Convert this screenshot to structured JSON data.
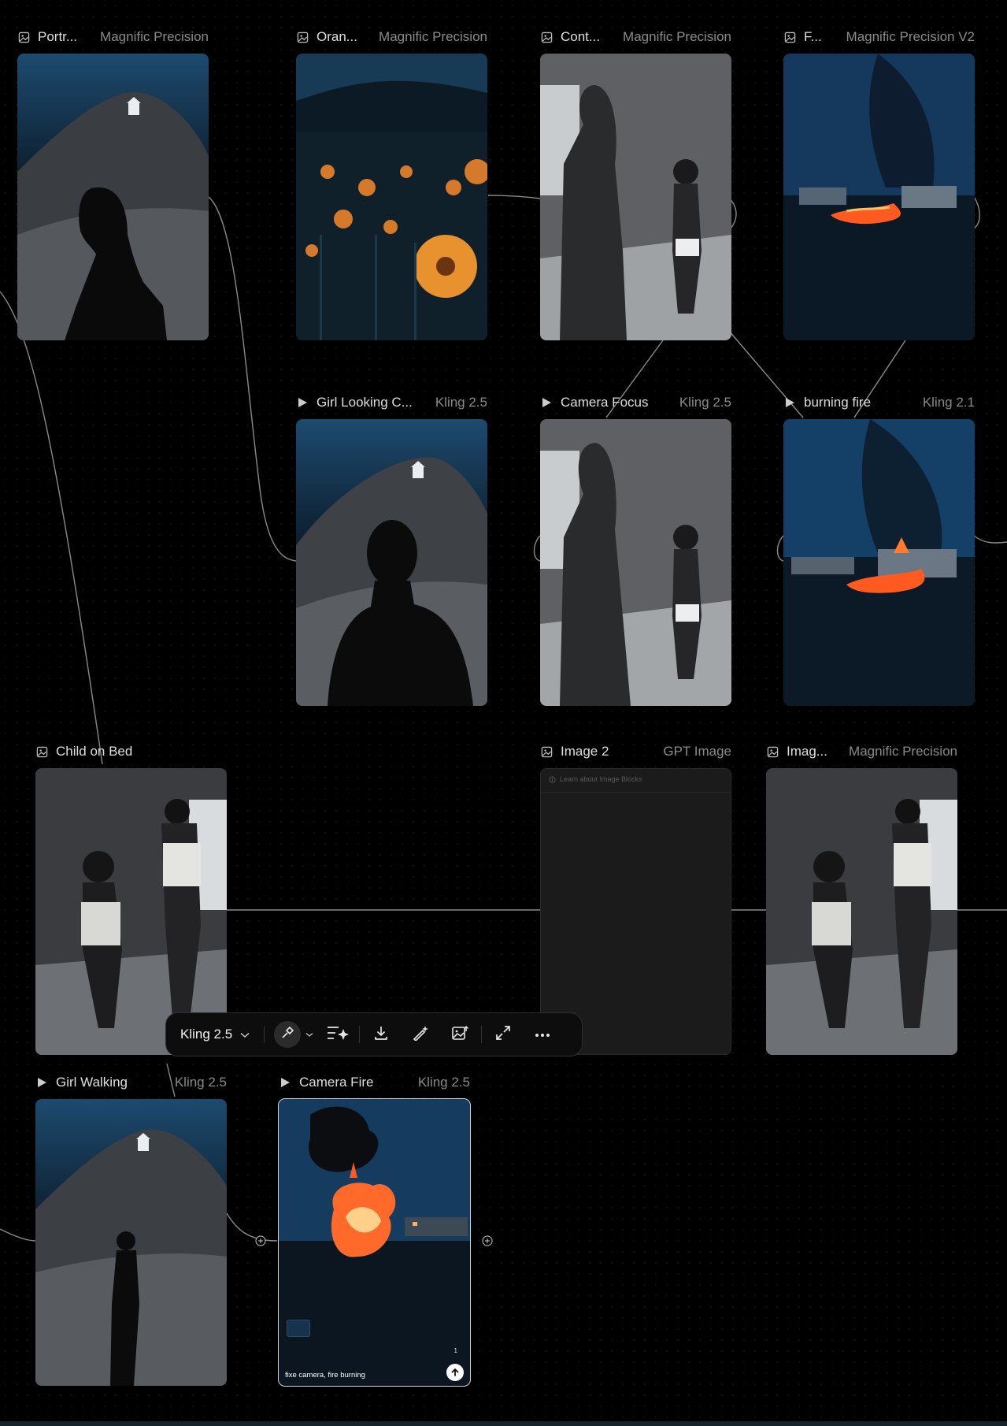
{
  "canvas": {
    "nodes": [
      {
        "type": "image",
        "title": "Portr...",
        "model": "Magnific Precision",
        "thumbnail": "portrait-hill-church"
      },
      {
        "type": "image",
        "title": "Oran...",
        "model": "Magnific Precision",
        "thumbnail": "orange-flowers"
      },
      {
        "type": "image",
        "title": "Cont...",
        "model": "Magnific Precision",
        "thumbnail": "mother-child-room"
      },
      {
        "type": "image",
        "title": "F...",
        "model": "Magnific Precision V2",
        "thumbnail": "village-fire"
      },
      {
        "type": "video",
        "title": "Girl Looking C...",
        "model": "Kling 2.5",
        "thumbnail": "girl-looking-camera"
      },
      {
        "type": "video",
        "title": "Camera Focus",
        "model": "Kling 2.5",
        "thumbnail": "mother-child-room"
      },
      {
        "type": "video",
        "title": "burning fire",
        "model": "Kling 2.1",
        "thumbnail": "village-fire"
      },
      {
        "type": "image",
        "title": "Child on Bed",
        "model": "",
        "thumbnail": "child-on-bed"
      },
      {
        "type": "image",
        "title": "Image 2",
        "model": "GPT Image",
        "thumbnail": "empty",
        "learn_text": "Learn about Image Blocks"
      },
      {
        "type": "image",
        "title": "Imag...",
        "model": "Magnific Precision",
        "thumbnail": "child-on-bed"
      },
      {
        "type": "video",
        "title": "Girl Walking",
        "model": "Kling 2.5",
        "thumbnail": "girl-walking-hill"
      },
      {
        "type": "video",
        "title": "Camera Fire",
        "model": "Kling 2.5",
        "thumbnail": "explosion",
        "selected": true,
        "prompt": "fixe camera, fire burning",
        "count": "1"
      }
    ]
  },
  "toolbar": {
    "model_label": "Kling 2.5",
    "buttons": [
      "style-brush",
      "enhance",
      "download",
      "edit",
      "image-upload",
      "expand",
      "more"
    ]
  },
  "icons": {
    "image": "image-icon",
    "video": "play-icon"
  },
  "colors": {
    "background": "#000000",
    "panel": "#1b1b1b",
    "accent_fire": "#ff6a2a",
    "night_blue": "#1a4a72"
  }
}
